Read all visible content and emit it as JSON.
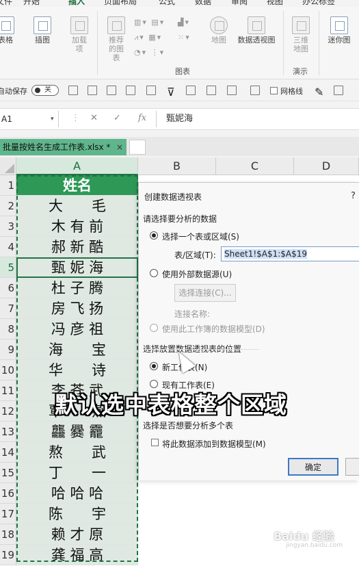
{
  "menu": {
    "tabs": [
      "文件",
      "开始",
      "插入",
      "页面布局",
      "公式",
      "数据",
      "审阅",
      "视图",
      "办公标签"
    ],
    "active_index": 2
  },
  "ribbon": {
    "table_label": "表格",
    "illustration_label": "插图",
    "addin_label": "加载项",
    "recommended_charts_label": "推荐的图表",
    "map_label": "地图",
    "pivot_chart_label": "数据透视图",
    "3d_map_label": "三维地图",
    "sparklines_label": "迷你图",
    "charts_group_label": "图表",
    "tours_group_label": "演示"
  },
  "qat": {
    "autosave_label": "自动保存",
    "autosave_state": "关",
    "gridlines_label": "网格线"
  },
  "formula_bar": {
    "name_box": "A1",
    "fx_label": "fx",
    "value": "甄妮海"
  },
  "workbook_tab": {
    "title": "批量按姓名生成工作表.xlsx *",
    "close_label": "×"
  },
  "columns": [
    "A",
    "B",
    "C",
    "D"
  ],
  "rows": [
    "1",
    "2",
    "3",
    "4",
    "5",
    "6",
    "7",
    "8",
    "9",
    "10",
    "11",
    "12",
    "13",
    "14",
    "15",
    "16",
    "17",
    "18",
    "19"
  ],
  "cells": [
    "姓名",
    "大　　毛",
    "木 有 前",
    "郝 新 酷",
    "甄 妮 海",
    "杜 子 腾",
    "房 飞 扬",
    "冯 彦 祖",
    "海　　宝",
    "华　　诗",
    "李 苍 武",
    "覃　　燕",
    "龘 爨 龗",
    "熬　　武",
    "丁　　一",
    "哈 哈 哈",
    "陈　　宇",
    "赖 才 原",
    "龚 福 高"
  ],
  "dialog": {
    "title": "创建数据透视表",
    "help": "?",
    "section1": "请选择要分析的数据",
    "option_table": "选择一个表或区域(S)",
    "range_label": "表/区域(T):",
    "range_value": "Sheet1!$A$1:$A$19",
    "option_external": "使用外部数据源(U)",
    "choose_connection": "选择连接(C)...",
    "connection_name": "连接名称:",
    "option_data_model": "使用此工作簿的数据模型(D)",
    "section2": "选择放置数据透视表的位置",
    "option_new_sheet": "新工作表(N)",
    "option_existing": "现有工作表(E)",
    "section3": "选择是否想要分析多个表",
    "add_to_model": "将此数据添加到数据模型(M)",
    "ok": "确定"
  },
  "caption": "默认选中表格整个区域",
  "watermark": {
    "main": "Baidu 经验",
    "sub": "jingyan.baidu.com"
  },
  "colors": {
    "excel_green": "#217346",
    "header_fill": "#2e9956",
    "tab_green": "#5fb58c"
  }
}
